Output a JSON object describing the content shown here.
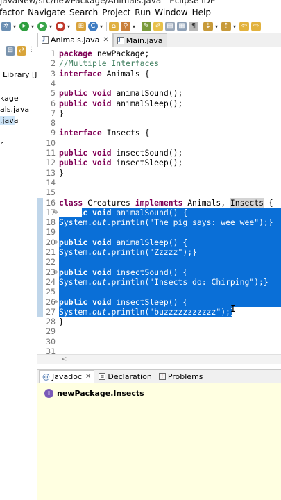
{
  "window": {
    "title": "javaNew/src/newPackage/Animals.java - Eclipse IDE"
  },
  "menu": [
    "factor",
    "Navigate",
    "Search",
    "Project",
    "Run",
    "Window",
    "Help"
  ],
  "colors": {
    "keyword": "#7f0055",
    "comment": "#3f7f5f",
    "string": "#2a00ff",
    "selection": "#0a6fd7",
    "javadoc_bg": "#ffffe1"
  },
  "left_panel": {
    "items": [
      {
        "label": "Library [Ja"
      },
      {
        "label": "kage"
      },
      {
        "label": "als.java"
      },
      {
        "label": ".java"
      },
      {
        "label": "r"
      }
    ]
  },
  "editor_tabs": [
    {
      "label": "Animals.java",
      "active": true,
      "close": "✕"
    },
    {
      "label": "Main.java",
      "active": false
    }
  ],
  "code_lines": [
    {
      "n": "1",
      "text": "package newPackage;"
    },
    {
      "n": "2",
      "text": "//Multiple Interfaces"
    },
    {
      "n": "3",
      "text": "interface Animals {"
    },
    {
      "n": "4",
      "text": ""
    },
    {
      "n": "5",
      "text": "public void animalSound();"
    },
    {
      "n": "6",
      "text": "public void animalSleep();"
    },
    {
      "n": "7",
      "text": "}"
    },
    {
      "n": "8",
      "text": ""
    },
    {
      "n": "9",
      "text": "interface Insects {"
    },
    {
      "n": "10",
      "text": ""
    },
    {
      "n": "11",
      "text": "public void insectSound();"
    },
    {
      "n": "12",
      "text": "public void insectSleep();"
    },
    {
      "n": "13",
      "text": "}"
    },
    {
      "n": "14",
      "text": ""
    },
    {
      "n": "15",
      "text": ""
    },
    {
      "n": "16",
      "text": "class Creatures implements Animals, Insects {"
    },
    {
      "n": "17",
      "text": "public void animalSound() {"
    },
    {
      "n": "18",
      "text": "System.out.println(\"The pig says: wee wee\");}"
    },
    {
      "n": "19",
      "text": ""
    },
    {
      "n": "20",
      "text": "public void animalSleep() {"
    },
    {
      "n": "21",
      "text": "System.out.println(\"Zzzzz\");}"
    },
    {
      "n": "22",
      "text": ""
    },
    {
      "n": "23",
      "text": "public void insectSound() {"
    },
    {
      "n": "24",
      "text": "System.out.println(\"Insects do: Chirping\");}"
    },
    {
      "n": "25",
      "text": ""
    },
    {
      "n": "26",
      "text": "public void insectSleep() {"
    },
    {
      "n": "27",
      "text": "System.out.println(\"buzzzzzzzzzzz\");}"
    },
    {
      "n": "28",
      "text": "}"
    },
    {
      "n": "29",
      "text": ""
    },
    {
      "n": "30",
      "text": ""
    },
    {
      "n": "31",
      "text": ""
    }
  ],
  "scroll_arrow": "<",
  "bottom_tabs": [
    {
      "label": "Javadoc",
      "icon": "at-icon",
      "active": true,
      "close": "✕"
    },
    {
      "label": "Declaration",
      "icon": "declaration-icon",
      "active": false
    },
    {
      "label": "Problems",
      "icon": "problems-icon",
      "active": false
    }
  ],
  "javadoc": {
    "title": "newPackage.Insects"
  }
}
